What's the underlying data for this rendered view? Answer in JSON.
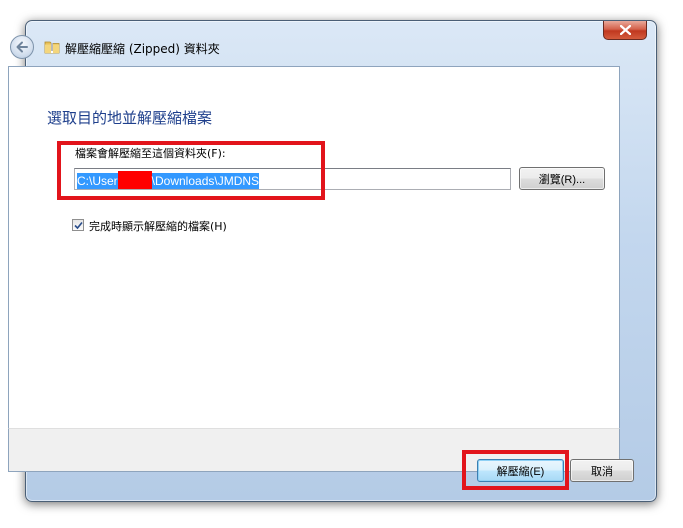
{
  "window": {
    "title": "解壓縮壓縮 (Zipped) 資料夾"
  },
  "dialog": {
    "heading": "選取目的地並解壓縮檔案",
    "folder_label": "檔案會解壓縮至這個資料夾(F):",
    "path_prefix": "C:\\User",
    "path_suffix": "\\Downloads\\JMDNS",
    "browse_label": "瀏覽(R)...",
    "show_when_complete": {
      "label": "完成時顯示解壓縮的檔案(H)",
      "checked": true
    }
  },
  "footer": {
    "extract_label": "解壓縮(E)",
    "cancel_label": "取消"
  },
  "colors": {
    "heading": "#1e3f8c",
    "selection": "#3399ff",
    "highlight_box": "#e2141b",
    "redaction": "#ff0000",
    "close_button": "#c0381f"
  },
  "icons": [
    "close-icon",
    "back-arrow-icon",
    "zip-folder-icon",
    "checkmark-icon"
  ]
}
